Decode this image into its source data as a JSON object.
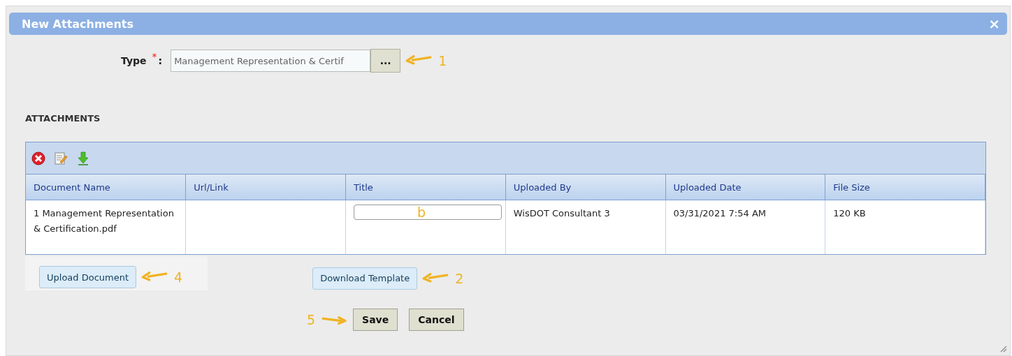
{
  "window": {
    "title": "New Attachments",
    "close": "×"
  },
  "type_field": {
    "label": "Type",
    "required_mark": "*",
    "colon": ":",
    "value": "Management Representation & Certif",
    "picker_button": "...",
    "annotation": {
      "label": "1",
      "arrow_first": true
    }
  },
  "section_title": "ATTACHMENTS",
  "table": {
    "columns": [
      "Document Name",
      "Url/Link",
      "Title",
      "Uploaded By",
      "Uploaded Date",
      "File Size"
    ],
    "rows": [
      {
        "cells": [
          "1 Management Representation & Certification.pdf",
          "",
          "",
          "WisDOT Consultant 3",
          "03/31/2021 7:54 AM",
          "120 KB"
        ],
        "title_annotation": "b"
      }
    ]
  },
  "upload_button": {
    "label": "Upload Document",
    "annotation": {
      "label": "4",
      "arrow_first": true
    }
  },
  "template_button": {
    "label": "Download Template",
    "annotation": {
      "label": "2",
      "arrow_first": true
    }
  },
  "buttons": [
    {
      "label": "Save",
      "annotation": {
        "label": "5",
        "arrow_first": false
      }
    },
    {
      "label": "Cancel"
    }
  ]
}
